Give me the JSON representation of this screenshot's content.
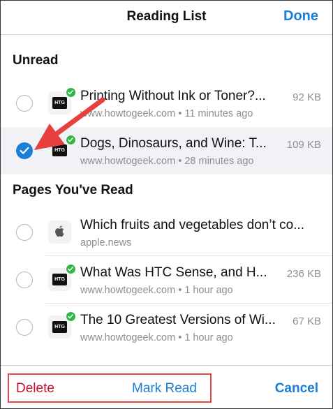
{
  "header": {
    "title": "Reading List",
    "done_label": "Done"
  },
  "sections": {
    "unread_title": "Unread",
    "read_title": "Pages You've Read"
  },
  "unread": [
    {
      "title": "Printing Without Ink or Toner?...",
      "subtitle": "www.howtogeek.com • 11 minutes ago",
      "size": "92 KB",
      "thumb_label": "HTG",
      "checked": false
    },
    {
      "title": "Dogs, Dinosaurs, and Wine: T...",
      "subtitle": "www.howtogeek.com • 28 minutes ago",
      "size": "109 KB",
      "thumb_label": "HTG",
      "checked": true
    }
  ],
  "read": [
    {
      "title": "Which fruits and vegetables don’t co...",
      "subtitle": "apple.news",
      "size": "",
      "thumb_label": ""
    },
    {
      "title": "What Was HTC Sense, and H...",
      "subtitle": "www.howtogeek.com • 1 hour ago",
      "size": "236 KB",
      "thumb_label": "HTG"
    },
    {
      "title": "The 10 Greatest Versions of Wi...",
      "subtitle": "www.howtogeek.com • 1 hour ago",
      "size": "67 KB",
      "thumb_label": "HTG"
    }
  ],
  "footer": {
    "delete_label": "Delete",
    "mark_read_label": "Mark Read",
    "cancel_label": "Cancel"
  },
  "colors": {
    "accent": "#1a7fd6",
    "destructive": "#c8102e",
    "badge": "#2db843",
    "annotation": "#e04a4a"
  }
}
